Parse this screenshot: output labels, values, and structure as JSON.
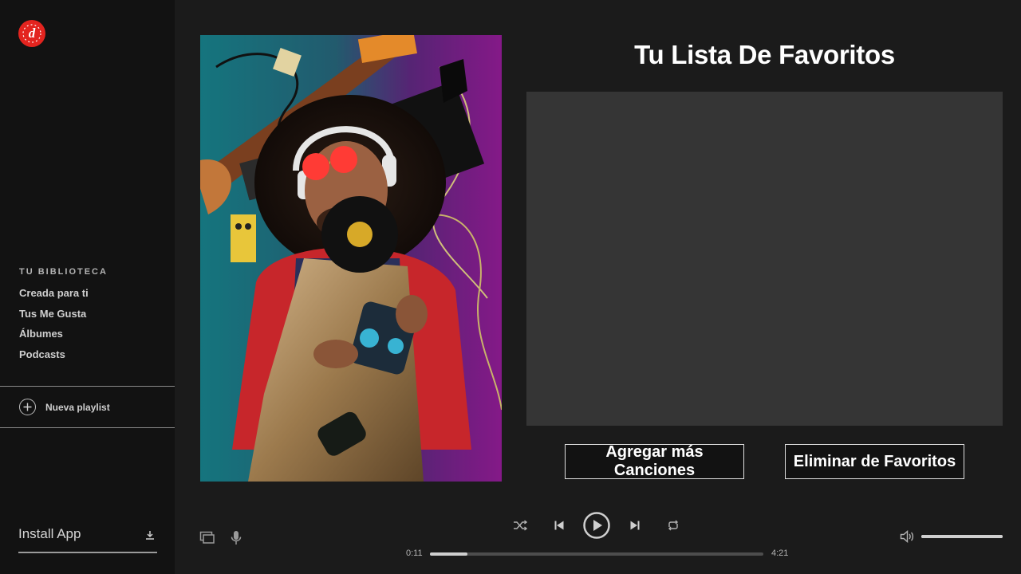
{
  "app": {
    "logo_letter": "d"
  },
  "sidebar": {
    "library_heading": "TU BIBLIOTECA",
    "items": [
      {
        "label": "Creada para ti"
      },
      {
        "label": "Tus Me Gusta"
      },
      {
        "label": "Álbumes"
      },
      {
        "label": "Podcasts"
      }
    ],
    "new_playlist_label": "Nueva playlist",
    "install_label": "Install App"
  },
  "main": {
    "title": "Tu Lista De Favoritos",
    "add_button": "Agregar más Canciones",
    "remove_button": "Eliminar de Favoritos"
  },
  "player": {
    "elapsed": "0:11",
    "duration": "4:21",
    "progress_fraction": 0.113,
    "volume_fraction": 1.0
  },
  "colors": {
    "accent_logo": "#e3241f",
    "sidebar_bg": "#121212",
    "main_bg": "#1b1b1b",
    "panel_bg": "#353535"
  },
  "icons": {
    "logo": "brand-logo-icon",
    "new_playlist": "plus-circle-icon",
    "install": "download-icon",
    "devices": "devices-icon",
    "mic": "microphone-icon",
    "shuffle": "shuffle-icon",
    "previous": "skip-back-icon",
    "play": "play-icon",
    "next": "skip-forward-icon",
    "repeat": "repeat-icon",
    "volume": "volume-icon"
  }
}
